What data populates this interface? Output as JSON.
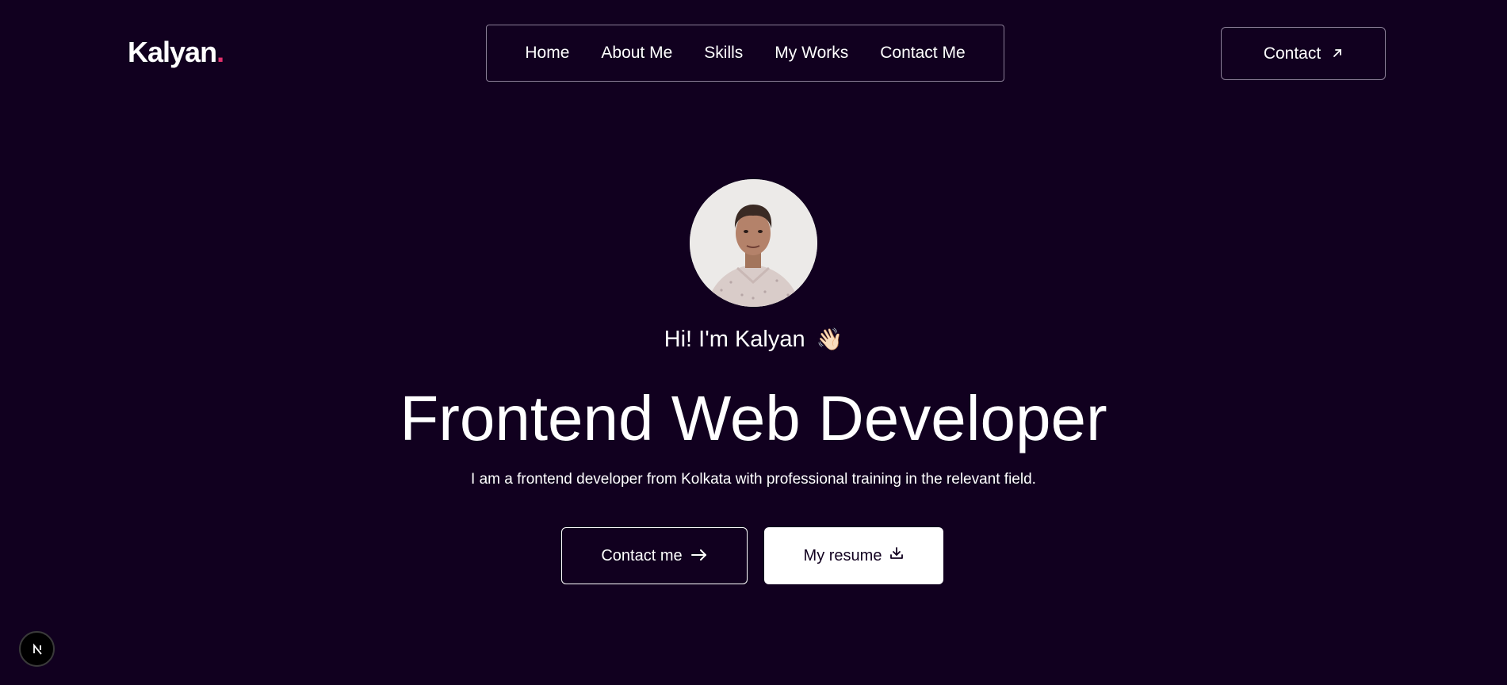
{
  "header": {
    "logo_text": "Kalyan",
    "logo_dot": ".",
    "nav": [
      {
        "label": "Home"
      },
      {
        "label": "About Me"
      },
      {
        "label": "Skills"
      },
      {
        "label": "My Works"
      },
      {
        "label": "Contact Me"
      }
    ],
    "contact_button": {
      "label": "Contact",
      "icon": "arrow-up-right-icon"
    }
  },
  "hero": {
    "greeting": "Hi! I'm Kalyan",
    "greeting_emoji": "👋🏻",
    "headline": "Frontend Web Developer",
    "subtext": "I am a frontend developer from Kolkata with professional training in the relevant field.",
    "buttons": {
      "contact": {
        "label": "Contact me",
        "icon": "arrow-right-icon"
      },
      "resume": {
        "label": "My resume",
        "icon": "download-icon"
      }
    }
  },
  "dev_badge": {
    "letter": "N"
  },
  "colors": {
    "background": "#11001f",
    "accent_dot": "#e1306c",
    "text": "#ffffff"
  }
}
